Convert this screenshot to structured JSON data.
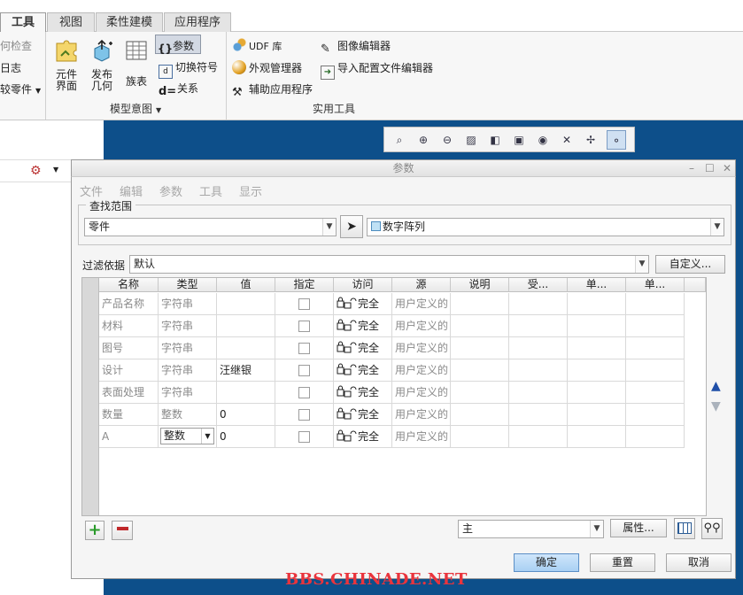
{
  "ribbon": {
    "tabs": [
      {
        "label": "工具",
        "active": true
      },
      {
        "label": "视图",
        "active": false
      },
      {
        "label": "柔性建模",
        "active": false
      },
      {
        "label": "应用程序",
        "active": false
      }
    ],
    "left_partial": [
      "何检查",
      "日志",
      "较零件"
    ],
    "model_intent": {
      "component_interface": "元件\n界面",
      "publish_geometry": "发布\n几何",
      "family_table": "族表",
      "parameters": "参数",
      "switch_symbols": "切换符号",
      "relations": "关系",
      "group_label": "模型意图"
    },
    "utilities": {
      "udf_library": "UDF 库",
      "appearance_manager": "外观管理器",
      "aux_apps": "辅助应用程序",
      "image_editor": "图像编辑器",
      "import_config_editor": "导入配置文件编辑器",
      "group_label": "实用工具"
    }
  },
  "dialog": {
    "title": "参数",
    "menus": [
      "文件",
      "编辑",
      "参数",
      "工具",
      "显示"
    ],
    "search_scope_label": "查找范围",
    "scope_value": "零件",
    "object_value": "数字阵列",
    "filter_label": "过滤依据",
    "filter_value": "默认",
    "customize_button": "自定义...",
    "columns": [
      "名称",
      "类型",
      "值",
      "指定",
      "访问",
      "源",
      "说明",
      "受...",
      "单...",
      "单..."
    ],
    "rows": [
      {
        "name": "产品名称",
        "type": "字符串",
        "value": "",
        "access": "完全",
        "source": "用户定义的"
      },
      {
        "name": "材料",
        "type": "字符串",
        "value": "",
        "access": "完全",
        "source": "用户定义的"
      },
      {
        "name": "图号",
        "type": "字符串",
        "value": "",
        "access": "完全",
        "source": "用户定义的"
      },
      {
        "name": "设计",
        "type": "字符串",
        "value": "汪继银",
        "access": "完全",
        "source": "用户定义的"
      },
      {
        "name": "表面处理",
        "type": "字符串",
        "value": "",
        "access": "完全",
        "source": "用户定义的"
      },
      {
        "name": "数量",
        "type": "整数",
        "value": "0",
        "access": "完全",
        "source": "用户定义的"
      },
      {
        "name": "A",
        "type": "整数",
        "value": "0",
        "access": "完全",
        "source": "用户定义的"
      }
    ],
    "bottom_combo": "主",
    "properties_button": "属性...",
    "ok_button": "确定",
    "reset_button": "重置",
    "cancel_button": "取消"
  },
  "watermark": "BBS.CHINADE.NET",
  "colors": {
    "viewport": "#0d4f8a",
    "watermark": "#e9343c",
    "add": "#2a9a2a",
    "remove": "#c0282a",
    "arrow": "#1f4fa8"
  }
}
